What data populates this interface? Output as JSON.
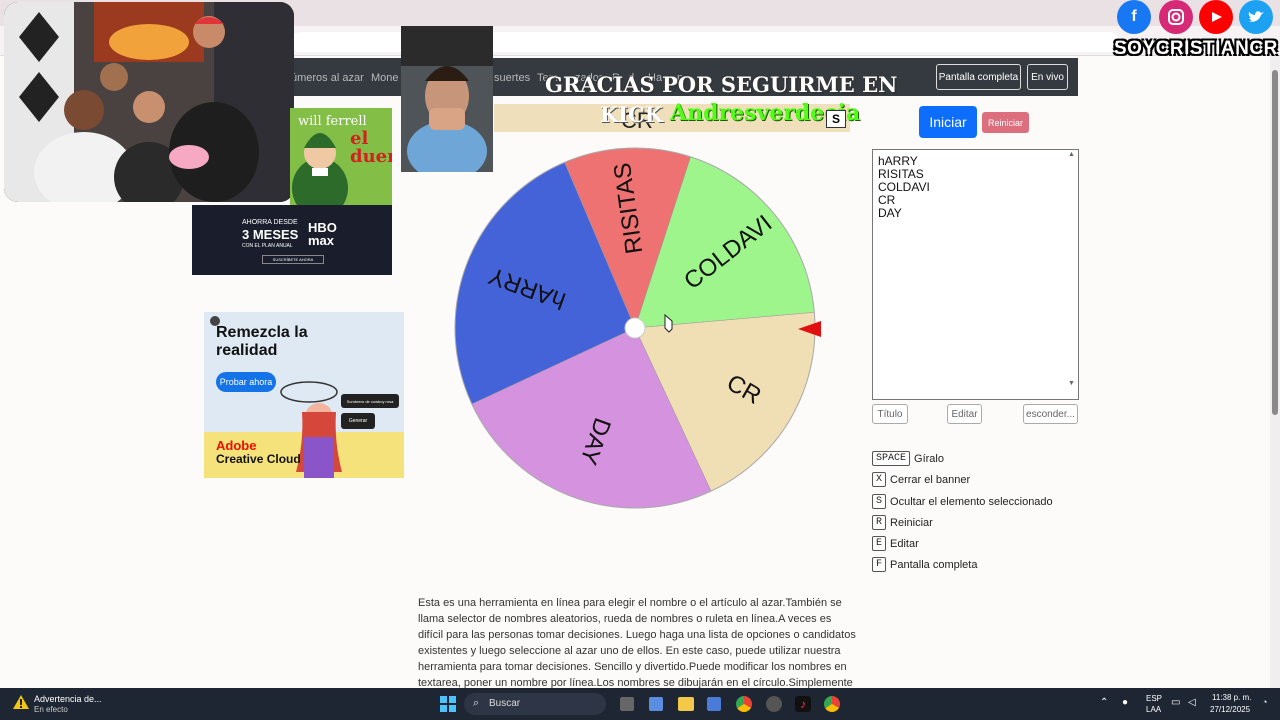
{
  "site": {
    "nav_links": [
      "úmeros al azar",
      "Mone",
      "suertes",
      "Tem",
      "zador",
      "R",
      "d",
      "Ha",
      "n"
    ],
    "nav_buttons": [
      "Pantalla completa",
      "En vivo"
    ]
  },
  "overlay": {
    "thanks": "GRACIAS POR SEGUIRME EN",
    "platform": "KICK",
    "user": "Andresverdecia",
    "badge": "S",
    "behind_text": "CR",
    "social_handle": "SOYCRISTIANCR"
  },
  "ads": {
    "movie_actor": "will ferrell",
    "movie_title": "el duende",
    "hbo_line1": "AHORRA DESDE",
    "hbo_line2": "3 MESES",
    "hbo_line3": "CON EL PLAN ANUAL",
    "hbo_brand": "HBO max",
    "hbo_cta": "SUSCRÍBETE AHORA",
    "adobe_title": "Remezcla la realidad",
    "adobe_cta": "Probar ahora",
    "adobe_brand": "Adobe",
    "adobe_product": "Creative Cloud",
    "adobe_prompt": "Sombrero de cowboy rosa",
    "adobe_generate": "Generar"
  },
  "wheel": {
    "pointer_color": "#e01010",
    "segments": [
      {
        "label": "hARRY",
        "color": "#4563d8"
      },
      {
        "label": "RISITAS",
        "color": "#ef7272"
      },
      {
        "label": "COLDAVI",
        "color": "#9df58c"
      },
      {
        "label": "CR",
        "color": "#f0deb4"
      },
      {
        "label": "DAY",
        "color": "#d592de"
      }
    ]
  },
  "controls": {
    "start": "Iniciar",
    "reset": "Reiniciar",
    "names_text": "hARRY\nRISITAS\nCOLDAVI\nCR\nDAY",
    "title_btn": "Título",
    "edit_btn": "Editar",
    "hide_btn": "esconder..."
  },
  "shortcuts": [
    {
      "key": "SPACE",
      "label": "Gíralo"
    },
    {
      "key": "X",
      "label": "Cerrar el banner"
    },
    {
      "key": "S",
      "label": "Ocultar el elemento seleccionado"
    },
    {
      "key": "R",
      "label": "Reiniciar"
    },
    {
      "key": "E",
      "label": "Editar"
    },
    {
      "key": "F",
      "label": "Pantalla completa"
    }
  ],
  "description": "Esta es una herramienta en línea para elegir el nombre o el artículo al azar.También se llama selector de nombres aleatorios, rueda de nombres o ruleta en línea.A veces es difícil para las personas tomar decisiones. Luego haga una lista de opciones o candidatos existentes y luego seleccione al azar uno de ellos. En este caso, puede utilizar nuestra herramienta para tomar decisiones. Sencillo y divertido.Puede modificar los nombres en textarea, poner un nombre por línea.Los nombres se dibujarán en el círculo.Simplemente haga clic en la rueda",
  "taskbar": {
    "notice_title": "Advertencia de...",
    "notice_sub": "En efecto",
    "search": "Buscar",
    "lang1": "ESP",
    "lang2": "LAA",
    "time": "11:38 p. m.",
    "date": "27/12/2025"
  }
}
